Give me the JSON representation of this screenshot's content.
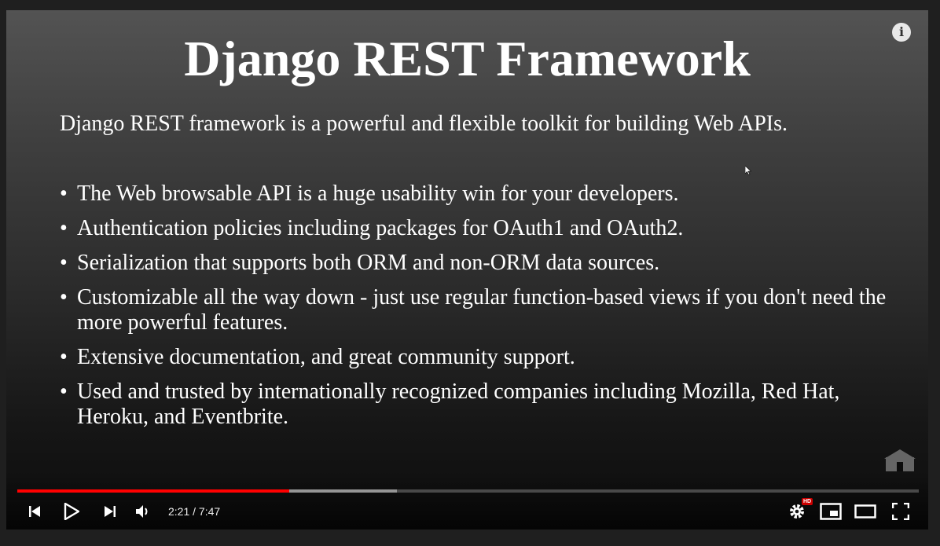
{
  "slide": {
    "title": "Django REST Framework",
    "intro": "Django REST framework is a powerful and flexible toolkit for building Web APIs.",
    "bullet_symbol": "•",
    "bullets": [
      "The Web browsable API is a huge usability win for your developers.",
      "Authentication policies including packages for OAuth1 and OAuth2.",
      "Serialization that supports both ORM and non-ORM data sources.",
      "Customizable all the way down - just use regular function-based views if you don't need the more powerful features.",
      "Extensive documentation, and great community support.",
      "Used and trusted by internationally recognized companies including Mozilla, Red Hat, Heroku, and Eventbrite."
    ]
  },
  "player": {
    "info_icon_glyph": "i",
    "time_display": "2:21 / 7:47",
    "progress_fraction": 0.3019,
    "buffered_fraction": 0.4213,
    "hd_badge": "HD",
    "colors": {
      "progress_played": "#ff0000",
      "hd_badge": "#cc0000"
    },
    "icons": [
      "previous-icon",
      "play-icon",
      "next-icon",
      "volume-icon",
      "settings-icon",
      "miniplayer-icon",
      "theater-mode-icon",
      "fullscreen-icon",
      "info-icon"
    ]
  }
}
